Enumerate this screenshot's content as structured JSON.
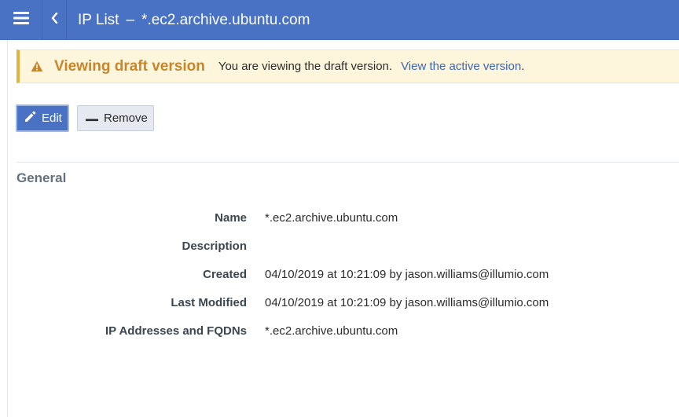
{
  "header": {
    "menu_icon": "hamburger-menu-icon",
    "back_icon": "chevron-left-icon",
    "title": "IP List",
    "separator": "–",
    "subtitle": "*.ec2.archive.ubuntu.com",
    "color": "#4a72c4"
  },
  "banner": {
    "icon": "warning-triangle-icon",
    "title": "Viewing draft version",
    "text": "You are viewing the draft version.",
    "link": "View the active version",
    "trailing": ".",
    "background": "#fdf5dc",
    "accent": "#c8862a"
  },
  "toolbar": {
    "edit_label": "Edit",
    "edit_icon": "pencil-icon",
    "remove_label": "Remove",
    "remove_icon": "minus-icon"
  },
  "section": {
    "title": "General"
  },
  "fields": [
    {
      "label": "Name",
      "value": "*.ec2.archive.ubuntu.com"
    },
    {
      "label": "Description",
      "value": ""
    },
    {
      "label": "Created",
      "value": "04/10/2019 at 10:21:09 by jason.williams@illumio.com"
    },
    {
      "label": "Last Modified",
      "value": "04/10/2019 at 10:21:09 by jason.williams@illumio.com"
    },
    {
      "label": "IP Addresses and FQDNs",
      "value": "*.ec2.archive.ubuntu.com"
    }
  ]
}
